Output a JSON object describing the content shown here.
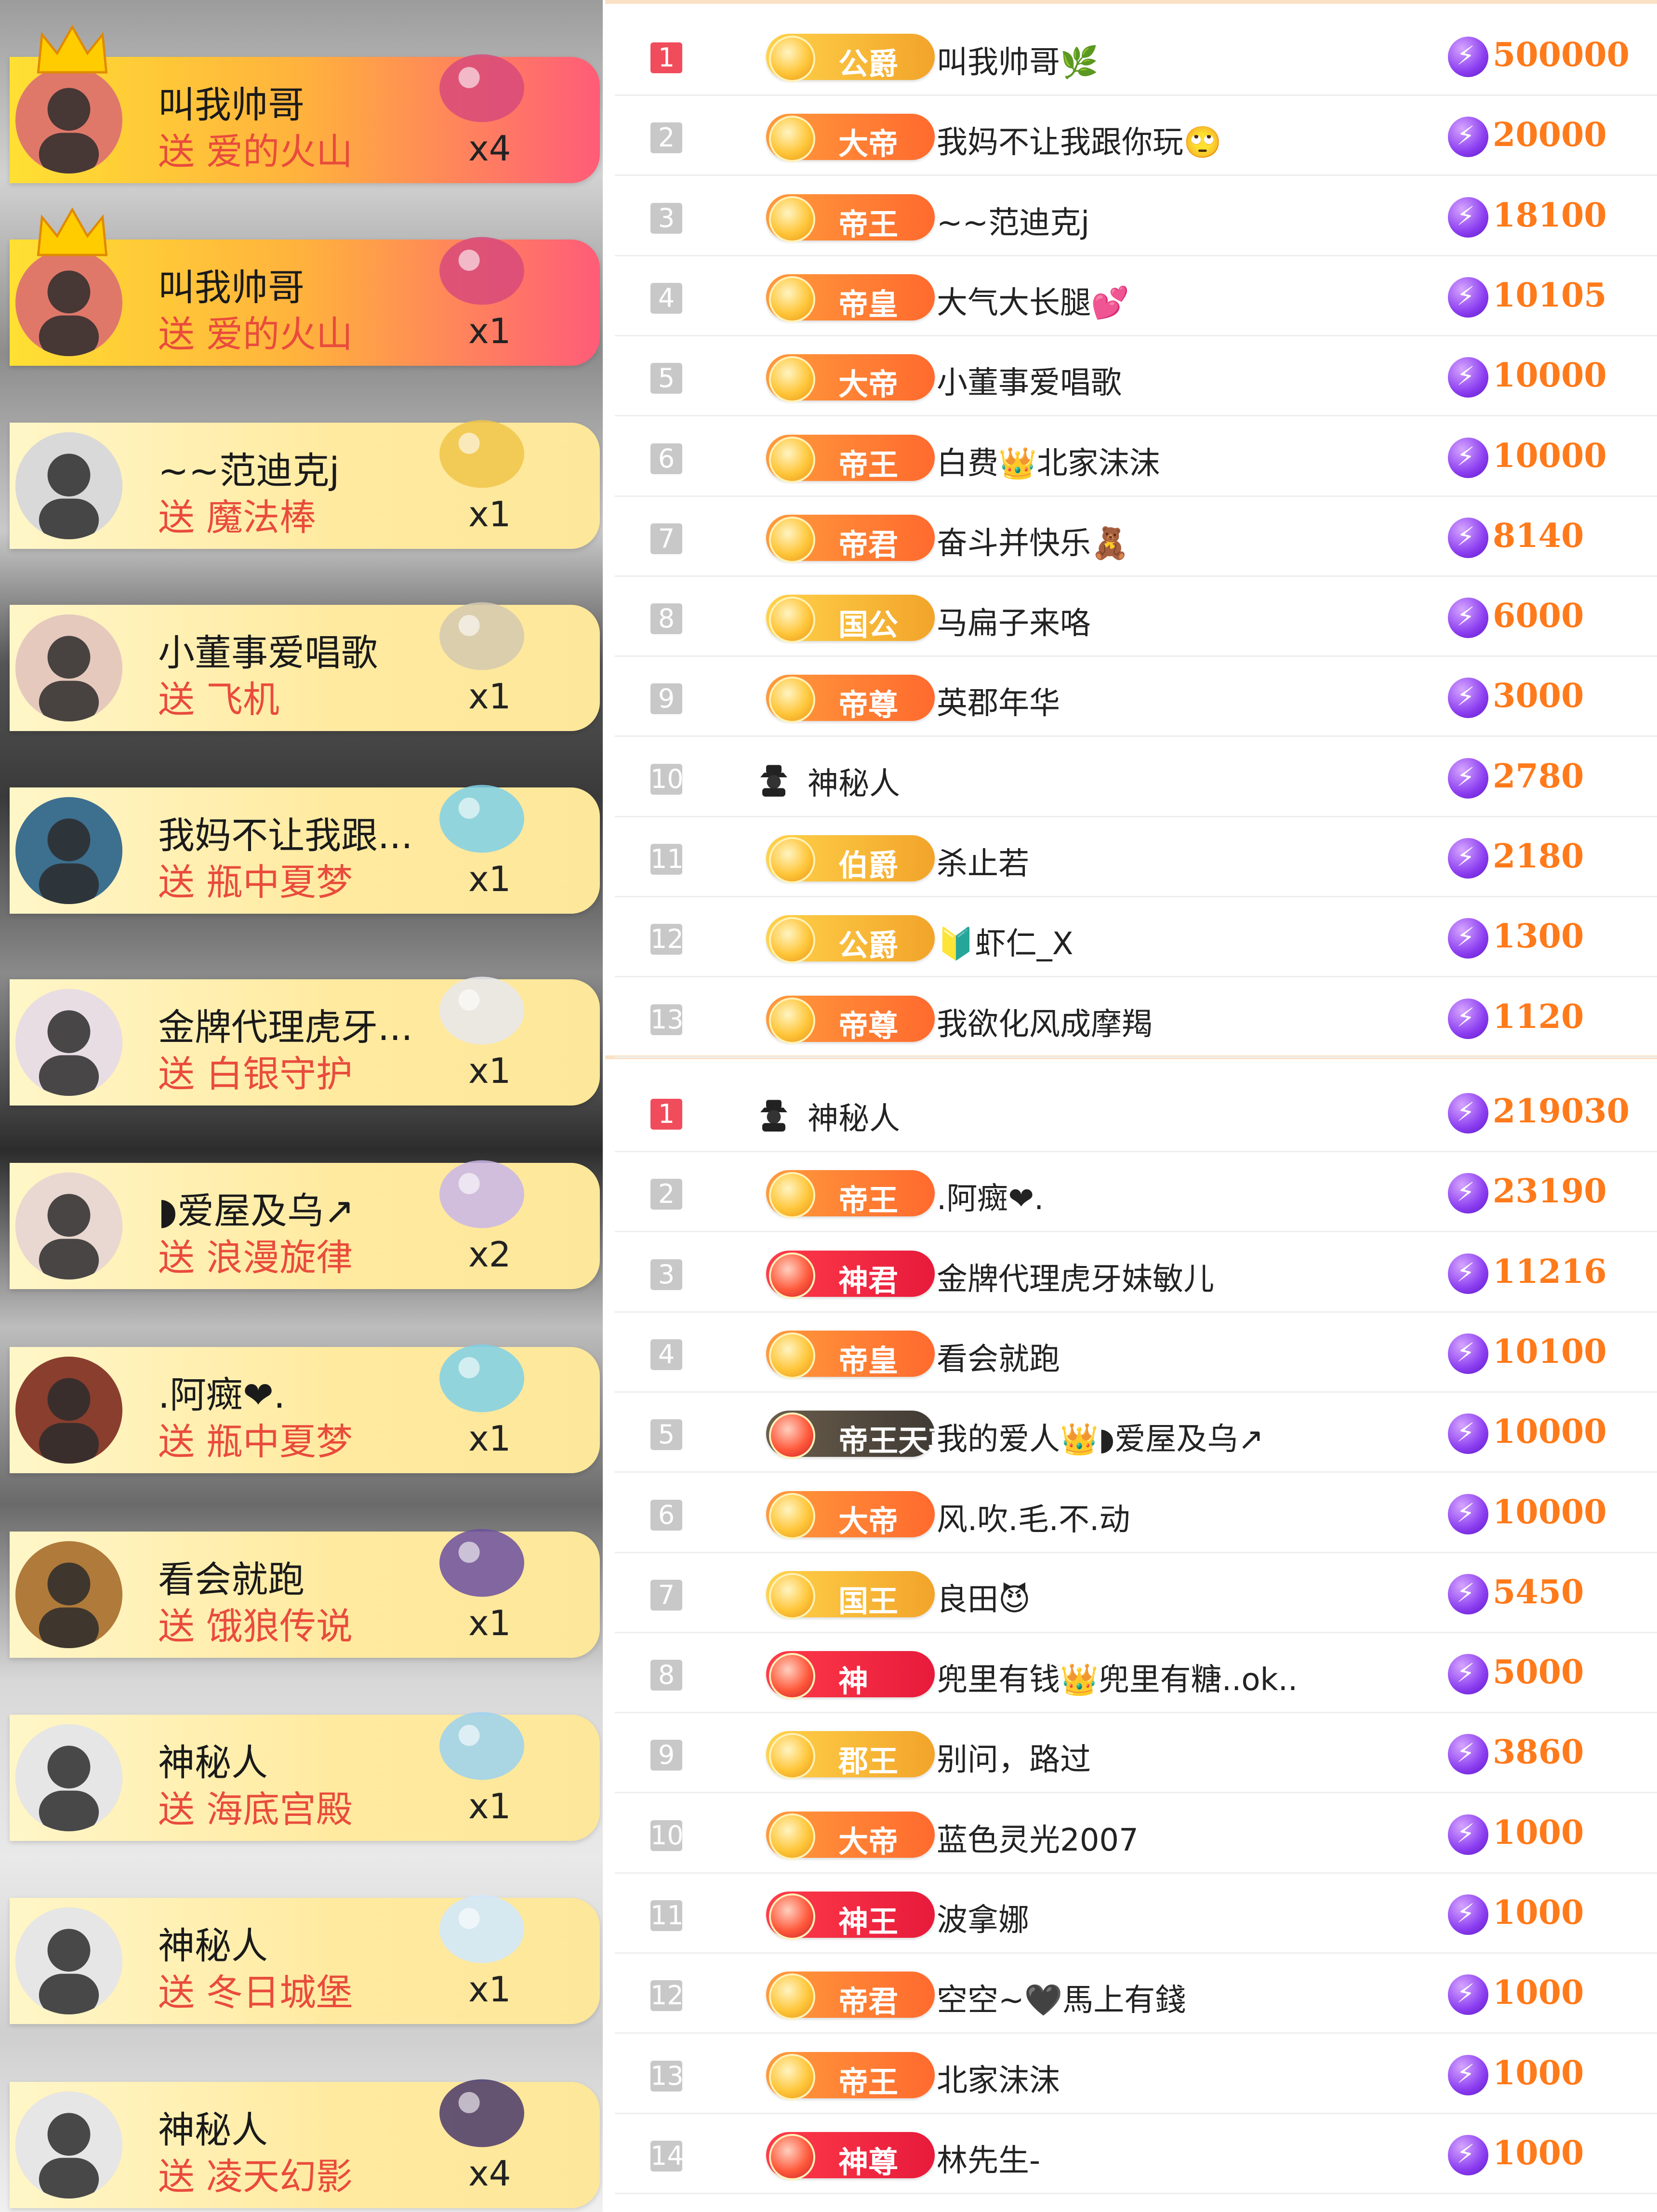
{
  "gift_feed": [
    {
      "name": "叫我帅哥",
      "verb": "送",
      "gift": "爱的火山",
      "count": "x4",
      "top": true,
      "avatar_color": "#e0786a"
    },
    {
      "name": "叫我帅哥",
      "verb": "送",
      "gift": "爱的火山",
      "count": "x1",
      "top": true,
      "avatar_color": "#e0786a"
    },
    {
      "name": "~~范迪克j",
      "verb": "送",
      "gift": "魔法棒",
      "count": "x1",
      "top": false,
      "avatar_color": "#d9d9d9"
    },
    {
      "name": "小董事爱唱歌",
      "verb": "送",
      "gift": "飞机",
      "count": "x1",
      "top": false,
      "avatar_color": "#e6c9bd"
    },
    {
      "name": "我妈不让我跟...",
      "verb": "送",
      "gift": "瓶中夏梦",
      "count": "x1",
      "top": false,
      "avatar_color": "#3d6f8f"
    },
    {
      "name": "金牌代理虎牙...",
      "verb": "送",
      "gift": "白银守护",
      "count": "x1",
      "top": false,
      "avatar_color": "#e9dde4"
    },
    {
      "name": "◗爱屋及乌↗",
      "verb": "送",
      "gift": "浪漫旋律",
      "count": "x2",
      "top": false,
      "avatar_color": "#e9d7d1"
    },
    {
      "name": ".阿癍❤.",
      "verb": "送",
      "gift": "瓶中夏梦",
      "count": "x1",
      "top": false,
      "avatar_color": "#8a3e2e"
    },
    {
      "name": "看会就跑",
      "verb": "送",
      "gift": "饿狼传说",
      "count": "x1",
      "top": false,
      "avatar_color": "#b07a3a"
    },
    {
      "name": "神秘人",
      "verb": "送",
      "gift": "海底宫殿",
      "count": "x1",
      "top": false,
      "avatar_color": "#e6e6e6"
    },
    {
      "name": "神秘人",
      "verb": "送",
      "gift": "冬日城堡",
      "count": "x1",
      "top": false,
      "avatar_color": "#e6e6e6"
    },
    {
      "name": "神秘人",
      "verb": "送",
      "gift": "凌天幻影",
      "count": "x4",
      "top": false,
      "avatar_color": "#e6e6e6"
    }
  ],
  "ranking_top": [
    {
      "rank": "1",
      "badge": "公爵",
      "style": "gold",
      "name": "叫我帅哥🌿",
      "value": "500000"
    },
    {
      "rank": "2",
      "badge": "大帝",
      "style": "orange",
      "name": "我妈不让我跟你玩🙄",
      "value": "20000"
    },
    {
      "rank": "3",
      "badge": "帝王",
      "style": "orange",
      "name": "~~范迪克j",
      "value": "18100"
    },
    {
      "rank": "4",
      "badge": "帝皇",
      "style": "orange",
      "name": "大气大长腿💕",
      "value": "10105"
    },
    {
      "rank": "5",
      "badge": "大帝",
      "style": "orange",
      "name": "小董事爱唱歌",
      "value": "10000"
    },
    {
      "rank": "6",
      "badge": "帝王",
      "style": "orange",
      "name": "白费👑北家沫沫",
      "value": "10000"
    },
    {
      "rank": "7",
      "badge": "帝君",
      "style": "orange",
      "name": "奋斗并快乐🧸",
      "value": "8140"
    },
    {
      "rank": "8",
      "badge": "国公",
      "style": "gold",
      "name": "马扁子来咯",
      "value": "6000"
    },
    {
      "rank": "9",
      "badge": "帝尊",
      "style": "orange",
      "name": "英郡年华",
      "value": "3000"
    },
    {
      "rank": "10",
      "badge": "",
      "style": "none",
      "name": "神秘人",
      "value": "2780"
    },
    {
      "rank": "11",
      "badge": "伯爵",
      "style": "gold",
      "name": "杀止若",
      "value": "2180"
    },
    {
      "rank": "12",
      "badge": "公爵",
      "style": "gold",
      "name": "🔰虾仁_X",
      "value": "1300"
    },
    {
      "rank": "13",
      "badge": "帝尊",
      "style": "orange",
      "name": "我欲化风成摩羯",
      "value": "1120"
    }
  ],
  "ranking_bottom": [
    {
      "rank": "1",
      "badge": "",
      "style": "none",
      "name": "神秘人",
      "value": "219030"
    },
    {
      "rank": "2",
      "badge": "帝王",
      "style": "orange",
      "name": ".阿癍❤.",
      "value": "23190"
    },
    {
      "rank": "3",
      "badge": "神君",
      "style": "red",
      "name": "金牌代理虎牙妹敏儿",
      "value": "11216"
    },
    {
      "rank": "4",
      "badge": "帝皇",
      "style": "orange",
      "name": "看会就跑",
      "value": "10100"
    },
    {
      "rank": "5",
      "badge": "帝王天尊",
      "style": "dark",
      "name": "我的爱人👑◗爱屋及乌↗",
      "value": "10000"
    },
    {
      "rank": "6",
      "badge": "大帝",
      "style": "orange",
      "name": "风.吹.毛.不.动",
      "value": "10000"
    },
    {
      "rank": "7",
      "badge": "国王",
      "style": "gold",
      "name": "良田😈",
      "value": "5450"
    },
    {
      "rank": "8",
      "badge": "神",
      "style": "red",
      "name": "兜里有钱👑兜里有糖..ok..",
      "value": "5000"
    },
    {
      "rank": "9",
      "badge": "郡王",
      "style": "gold",
      "name": "别问，路过",
      "value": "3860"
    },
    {
      "rank": "10",
      "badge": "大帝",
      "style": "orange",
      "name": "蓝色灵光2007",
      "value": "1000"
    },
    {
      "rank": "11",
      "badge": "神王",
      "style": "red",
      "name": "波拿娜",
      "value": "1000"
    },
    {
      "rank": "12",
      "badge": "帝君",
      "style": "orange",
      "name": "空空~🖤馬上有錢",
      "value": "1000"
    },
    {
      "rank": "13",
      "badge": "帝王",
      "style": "orange",
      "name": "北家沫沫",
      "value": "1000"
    },
    {
      "rank": "14",
      "badge": "神尊",
      "style": "red",
      "name": "林先生-",
      "value": "1000"
    }
  ]
}
